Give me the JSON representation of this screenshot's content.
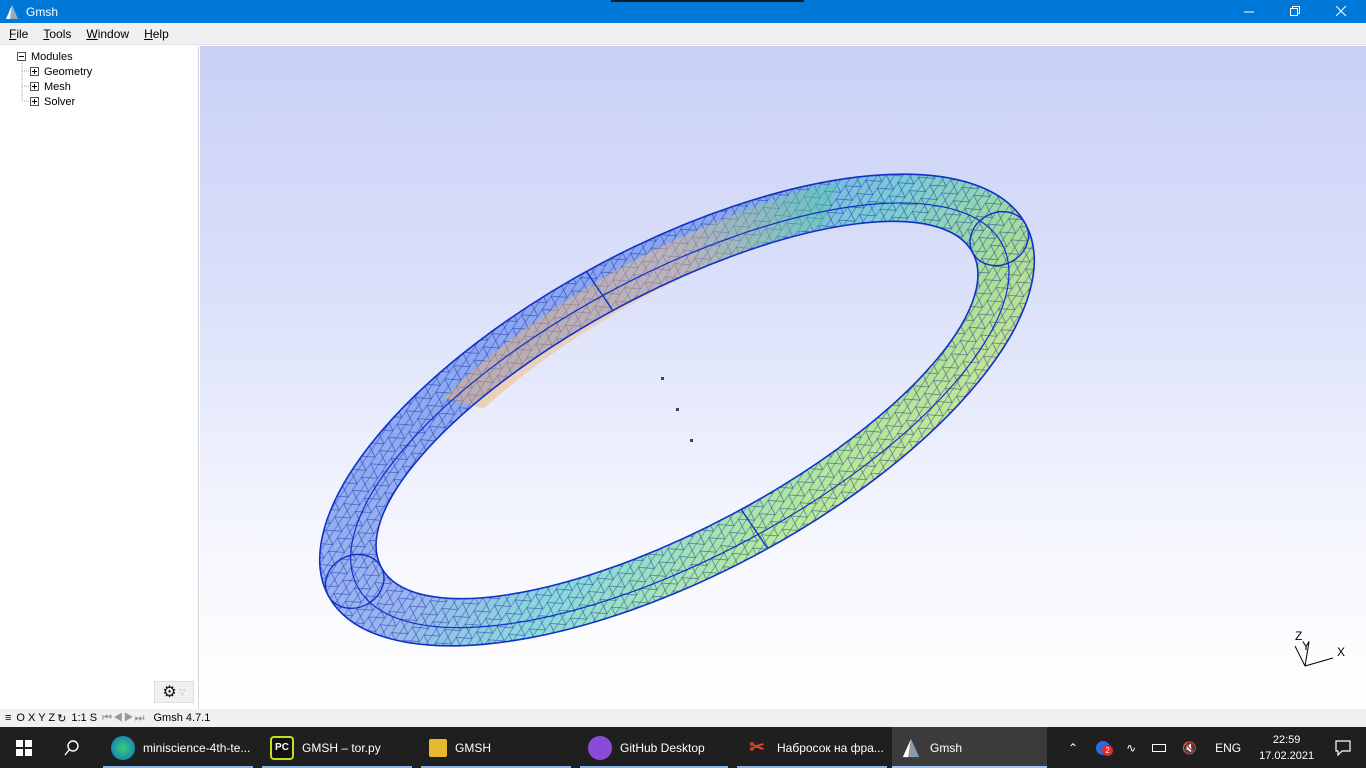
{
  "window": {
    "title": "Gmsh"
  },
  "menu": [
    {
      "label": "File",
      "underline": "F",
      "rest": "ile"
    },
    {
      "label": "Tools",
      "underline": "T",
      "rest": "ools"
    },
    {
      "label": "Window",
      "underline": "W",
      "rest": "indow"
    },
    {
      "label": "Help",
      "underline": "H",
      "rest": "elp"
    }
  ],
  "tree": {
    "root": "Modules",
    "items": [
      "Geometry",
      "Mesh",
      "Solver"
    ]
  },
  "statusbar": {
    "axes": "O X Y Z",
    "scale": "1:1 S",
    "message": "Gmsh 4.7.1"
  },
  "axes_labels": {
    "z": "Z",
    "y": "Y",
    "x": "X"
  },
  "taskbar": {
    "items": [
      {
        "label": "miniscience-4th-te...",
        "icon": "edge-icon"
      },
      {
        "label": "GMSH – tor.py",
        "icon": "pycharm-icon"
      },
      {
        "label": "GMSH",
        "icon": "folder-icon"
      },
      {
        "label": "GitHub Desktop",
        "icon": "github-icon"
      },
      {
        "label": "Набросок на фра...",
        "icon": "snip-icon"
      },
      {
        "label": "Gmsh",
        "icon": "gmsh-icon"
      }
    ],
    "lang": "ENG",
    "time": "22:59",
    "date": "17.02.2021",
    "badge": "2"
  },
  "colors": {
    "titlebar": "#0078d7",
    "taskbar": "#1f1f1f",
    "mesh_blue": "#1230c8"
  }
}
